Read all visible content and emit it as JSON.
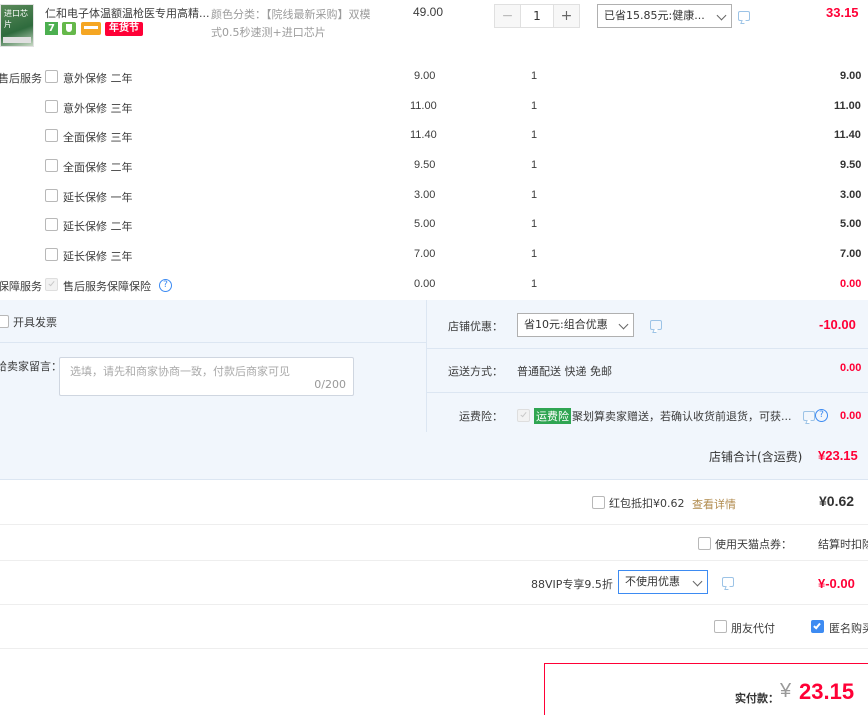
{
  "product": {
    "name": "仁和电子体温额温枪医专用高精...",
    "thumb_text": "进口芯片",
    "badge_seven": "7",
    "badge_newyear": "年货节",
    "spec_line1": "颜色分类：【院线最新采购】双模",
    "spec_line2": "式0.5秒速测+进口芯片",
    "unit_price": "49.00",
    "quantity": "1",
    "discount_select": "已省15.85元:健康...",
    "subtotal": "33.15"
  },
  "after_sales": {
    "section_label": "售后服务",
    "items": [
      {
        "label": "意外保修 二年",
        "price": "9.00",
        "qty": "1",
        "total": "9.00"
      },
      {
        "label": "意外保修 三年",
        "price": "11.00",
        "qty": "1",
        "total": "11.00"
      },
      {
        "label": "全面保修 三年",
        "price": "11.40",
        "qty": "1",
        "total": "11.40"
      },
      {
        "label": "全面保修 二年",
        "price": "9.50",
        "qty": "1",
        "total": "9.50"
      },
      {
        "label": "延长保修 一年",
        "price": "3.00",
        "qty": "1",
        "total": "3.00"
      },
      {
        "label": "延长保修 二年",
        "price": "5.00",
        "qty": "1",
        "total": "5.00"
      },
      {
        "label": "延长保修 三年",
        "price": "7.00",
        "qty": "1",
        "total": "7.00"
      }
    ]
  },
  "guarantee": {
    "section_label": "保障服务",
    "label": "售后服务保障保险",
    "price": "0.00",
    "qty": "1",
    "total": "0.00"
  },
  "invoice": {
    "label": "开具发票"
  },
  "message": {
    "label": "给卖家留言：",
    "placeholder": "选填，请先和商家协商一致，付款后商家可见",
    "counter": "0/200"
  },
  "shop_discount": {
    "label": "店铺优惠：",
    "select": "省10元:组合优惠",
    "amount": "-10.00"
  },
  "shipping": {
    "label": "运送方式：",
    "value": "普通配送 快递 免邮",
    "amount": "0.00"
  },
  "freight_insurance": {
    "label": "运费险：",
    "tag": "运费险",
    "text": "聚划算卖家赠送，若确认收货前退货，可获...",
    "amount": "0.00"
  },
  "shop_total": {
    "label": "店铺合计(含运费)",
    "amount": "¥23.15"
  },
  "red_packet": {
    "label": "红包抵扣¥0.62",
    "link": "查看详情",
    "amount": "¥0.62"
  },
  "tmall_points": {
    "label": "使用天猫点券：",
    "note": "结算时扣除"
  },
  "vip": {
    "label": "88VIP专享9.5折",
    "select": "不使用优惠",
    "amount": "¥-0.00"
  },
  "friend_pay": {
    "label": "朋友代付"
  },
  "anonymous": {
    "label": "匿名购买"
  },
  "pay": {
    "label": "实付款：",
    "currency": "¥",
    "amount": "23.15"
  },
  "colors": {
    "accent_red": "#ff0036",
    "link_blue": "#3d8bf2",
    "panel_bg": "#f1f6fc"
  }
}
